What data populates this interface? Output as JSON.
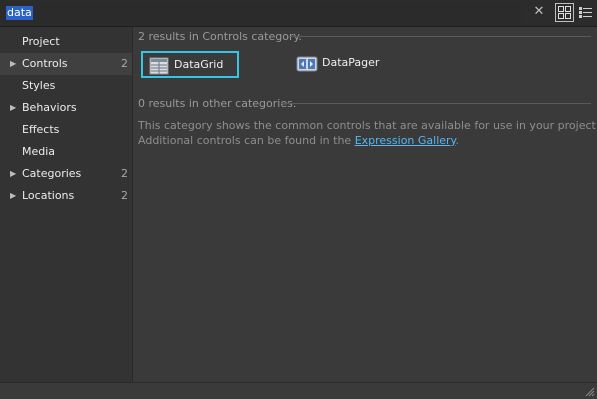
{
  "search": {
    "value": "data",
    "placeholder": ""
  },
  "sidebar": {
    "items": [
      {
        "label": "Project",
        "count": "",
        "has_arrow": false
      },
      {
        "label": "Controls",
        "count": "2",
        "has_arrow": true,
        "selected": true
      },
      {
        "label": "Styles",
        "count": "",
        "has_arrow": false
      },
      {
        "label": "Behaviors",
        "count": "",
        "has_arrow": true
      },
      {
        "label": "Effects",
        "count": "",
        "has_arrow": false
      },
      {
        "label": "Media",
        "count": "",
        "has_arrow": false
      },
      {
        "label": "Categories",
        "count": "2",
        "has_arrow": true
      },
      {
        "label": "Locations",
        "count": "2",
        "has_arrow": true
      }
    ],
    "arrow_glyph": "▶"
  },
  "main": {
    "category_header": "2 results in Controls category.",
    "results": [
      {
        "label": "DataGrid",
        "icon": "datagrid-icon",
        "selected": true
      },
      {
        "label": "DataPager",
        "icon": "datapager-icon",
        "selected": false
      }
    ],
    "other_header": "0 results in other categories.",
    "description_line1": "This category shows the common controls that are available for use in your project.",
    "description_line2_prefix": "Additional controls can be found in the ",
    "description_link": "Expression Gallery",
    "description_line2_suffix": "."
  },
  "toolbar": {
    "clear_glyph": "✕",
    "grid_view_icon": "grid-view-icon",
    "list_view_icon": "list-view-icon"
  },
  "colors": {
    "selection_border": "#35c6e5",
    "link": "#56b7f3",
    "search_highlight": "#2a62c9"
  }
}
